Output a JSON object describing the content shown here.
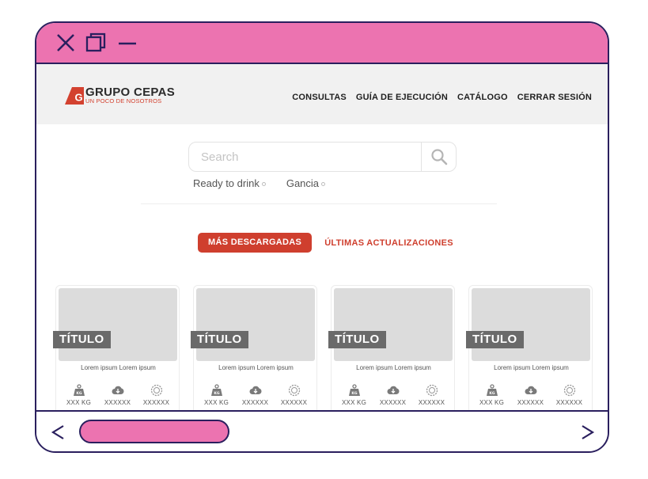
{
  "window": {
    "controls": [
      "close-icon",
      "maximize-icon",
      "minimize-icon"
    ],
    "accent_color": "#ec73b0",
    "border_color": "#2a1f5e"
  },
  "header": {
    "logo": {
      "title": "GRUPO CEPAS",
      "subtitle": "UN POCO DE NOSOTROS",
      "mark_letter": "G",
      "brand_color": "#d3412f"
    },
    "nav": [
      "CONSULTAS",
      "GUÍA DE EJECUCIÓN",
      "CATÁLOGO",
      "CERRAR SESIÓN"
    ]
  },
  "search": {
    "placeholder": "Search",
    "value": "",
    "icon": "search-icon"
  },
  "chips": [
    "Ready to drink",
    "Gancia"
  ],
  "tabs": {
    "active": "MÁS DESCARGADAS",
    "inactive": "ÚLTIMAS ACTUALIZACIONES"
  },
  "cards": [
    {
      "title": "TÍTULO",
      "description": "Lorem ipsum Lorem ipsum",
      "weight": "XXX KG",
      "downloads": "XXXXXX",
      "updates": "XXXXXX"
    },
    {
      "title": "TÍTULO",
      "description": "Lorem ipsum Lorem ipsum",
      "weight": "XXX KG",
      "downloads": "XXXXXX",
      "updates": "XXXXXX"
    },
    {
      "title": "TÍTULO",
      "description": "Lorem ipsum Lorem ipsum",
      "weight": "XXX KG",
      "downloads": "XXXXXX",
      "updates": "XXXXXX"
    },
    {
      "title": "TÍTULO",
      "description": "Lorem ipsum Lorem ipsum",
      "weight": "XXX KG",
      "downloads": "XXXXXX",
      "updates": "XXXXXX"
    }
  ],
  "icons": {
    "weight": "weight-kg-icon",
    "download": "cloud-download-icon",
    "badge": "badge-icon"
  },
  "scrollbar": {
    "left": "chevron-left-icon",
    "right": "chevron-right-icon"
  }
}
